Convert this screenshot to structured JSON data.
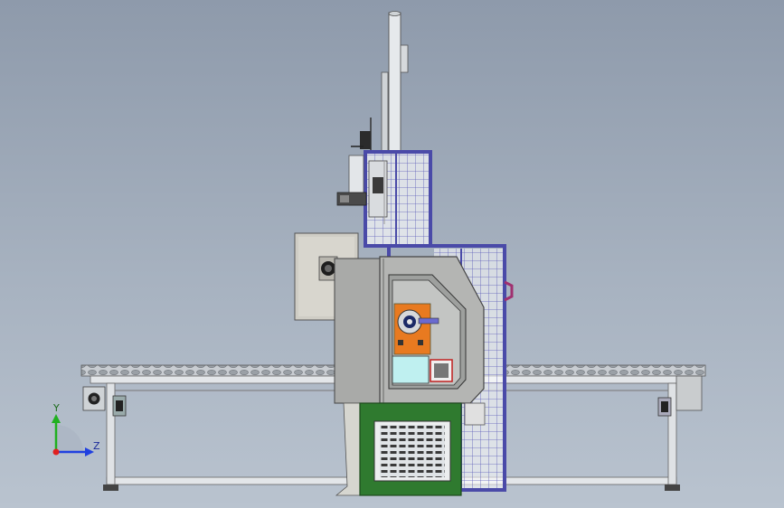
{
  "triad": {
    "y_label": "Y",
    "z_label": "Z",
    "colors": {
      "y": "#20b020",
      "z": "#2040e0",
      "origin": "#e02020"
    }
  },
  "colors": {
    "background_top": "#8e9aab",
    "background_bottom": "#b9c3cf",
    "guard_frame": "#4a4aa8",
    "cabinet_green": "#2f7a2f",
    "fixture_orange": "#e87a20",
    "panel_cyan": "#bff0f0",
    "housing_gray": "#b0b0b0",
    "accent_magenta": "#a03070"
  }
}
